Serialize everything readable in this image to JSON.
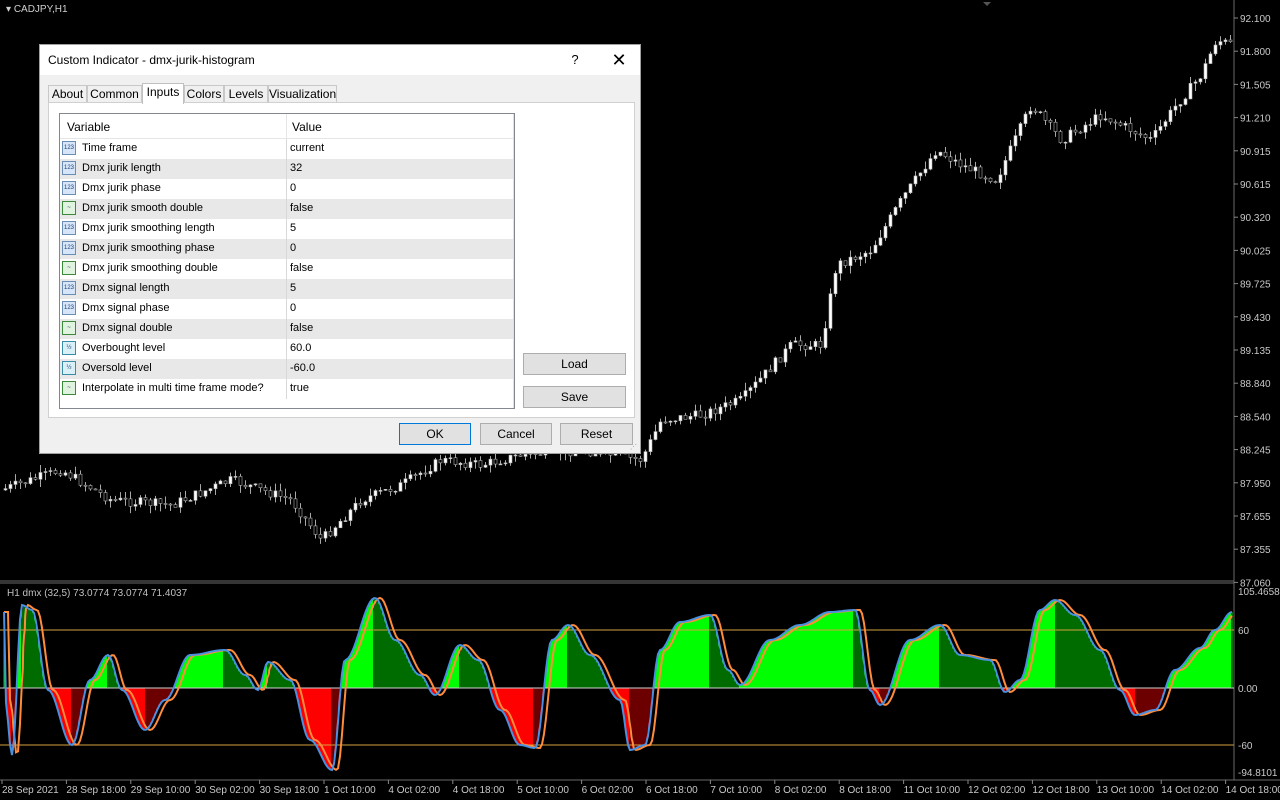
{
  "chart": {
    "symbol": "CADJPY,H1",
    "price_scale": [
      "92.100",
      "91.800",
      "91.505",
      "91.210",
      "90.915",
      "90.615",
      "90.320",
      "90.025",
      "89.725",
      "89.430",
      "89.135",
      "88.840",
      "88.540",
      "88.245",
      "87.950",
      "87.655",
      "87.355",
      "87.060"
    ],
    "time_labels": [
      "28 Sep 2021",
      "28 Sep 18:00",
      "29 Sep 10:00",
      "30 Sep 02:00",
      "30 Sep 18:00",
      "1 Oct 10:00",
      "4 Oct 02:00",
      "4 Oct 18:00",
      "5 Oct 10:00",
      "6 Oct 02:00",
      "6 Oct 18:00",
      "7 Oct 10:00",
      "8 Oct 02:00",
      "8 Oct 18:00",
      "11 Oct 10:00",
      "12 Oct 02:00",
      "12 Oct 18:00",
      "13 Oct 10:00",
      "14 Oct 02:00",
      "14 Oct 18:00"
    ]
  },
  "indicator": {
    "info": "H1 dmx (32,5) 73.0774 73.0774 71.4037",
    "scale": [
      "105.4658",
      "60",
      "0.00",
      "-60",
      "-94.8101"
    ],
    "colors": {
      "up": "#00ff00",
      "down": "#ff0000",
      "main": "#4a90e0",
      "signal": "#ff8c3c",
      "level": "#d6a040"
    }
  },
  "dialog": {
    "title": "Custom Indicator - dmx-jurik-histogram",
    "help": "?",
    "close": "✕",
    "tabs": [
      "About",
      "Common",
      "Inputs",
      "Colors",
      "Levels",
      "Visualization"
    ],
    "columns": {
      "variable": "Variable",
      "value": "Value"
    },
    "params": [
      {
        "name": "Time frame",
        "value": "current",
        "icon": "123"
      },
      {
        "name": "Dmx jurik length",
        "value": "32",
        "icon": "123"
      },
      {
        "name": "Dmx jurik phase",
        "value": "0",
        "icon": "123"
      },
      {
        "name": "Dmx jurik smooth double",
        "value": "false",
        "icon": "bool"
      },
      {
        "name": "Dmx jurik smoothing length",
        "value": "5",
        "icon": "123"
      },
      {
        "name": "Dmx jurik smoothing phase",
        "value": "0",
        "icon": "123"
      },
      {
        "name": "Dmx jurik smoothing double",
        "value": "false",
        "icon": "bool"
      },
      {
        "name": "Dmx signal length",
        "value": "5",
        "icon": "123"
      },
      {
        "name": "Dmx signal phase",
        "value": "0",
        "icon": "123"
      },
      {
        "name": "Dmx signal double",
        "value": "false",
        "icon": "bool"
      },
      {
        "name": "Overbought level",
        "value": "60.0",
        "icon": "v2"
      },
      {
        "name": "Oversold level",
        "value": "-60.0",
        "icon": "v2"
      },
      {
        "name": "Interpolate in multi time frame mode?",
        "value": "true",
        "icon": "bool"
      }
    ],
    "buttons": {
      "load": "Load",
      "save": "Save",
      "ok": "OK",
      "cancel": "Cancel",
      "reset": "Reset"
    }
  }
}
